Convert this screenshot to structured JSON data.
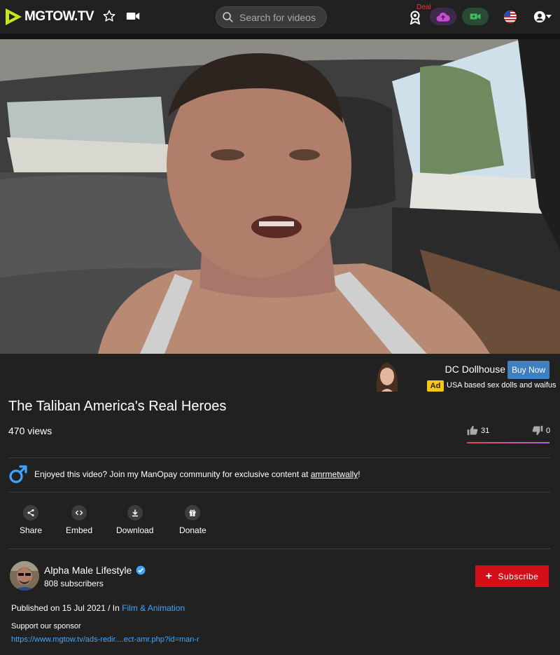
{
  "header": {
    "logo_text": "MGTOW.TV",
    "search_placeholder": "Search for videos",
    "deal_label": "Deal",
    "colors": {
      "background": "#212121",
      "upload_pill": "#3d2a4a",
      "upload_icon": "#c94bd8",
      "record_pill": "#2b4a33",
      "record_icon": "#3fbf62"
    },
    "icons": [
      "star-icon",
      "video-camera-icon",
      "search-icon",
      "award-ribbon-icon",
      "upload-cloud-icon",
      "record-video-icon",
      "us-flag-icon",
      "account-icon",
      "chevron-down-icon"
    ]
  },
  "ad": {
    "title": "DC Dollhouse",
    "buy_label": "Buy Now",
    "badge": "Ad",
    "description": "USA based sex dolls and waifus"
  },
  "video": {
    "title": "The Taliban America's Real Heroes",
    "views": "470 views",
    "likes": "31",
    "dislikes": "0"
  },
  "promo": {
    "text_before": "Enjoyed this video? Join my ManOpay community for exclusive content at ",
    "link_text": "amrmetwally",
    "text_after": "!"
  },
  "actions": {
    "share": "Share",
    "embed": "Embed",
    "download": "Download",
    "donate": "Donate"
  },
  "channel": {
    "name": "Alpha Male Lifestyle",
    "subscribers": "808 subscribers",
    "subscribe_label": "Subscribe"
  },
  "details": {
    "published_prefix": "Published on 15 Jul 2021 / In ",
    "category": "Film & Animation",
    "support_text": "Support our sponsor",
    "sponsor_link": "https://www.mgtow.tv/ads-redir....ect-amr.php?id=man-r"
  },
  "accent_colors": {
    "subscribe": "#d50f1a",
    "buy_now": "#3e7fc1",
    "link": "#3ea6ff",
    "ad_badge": "#f5c518"
  }
}
